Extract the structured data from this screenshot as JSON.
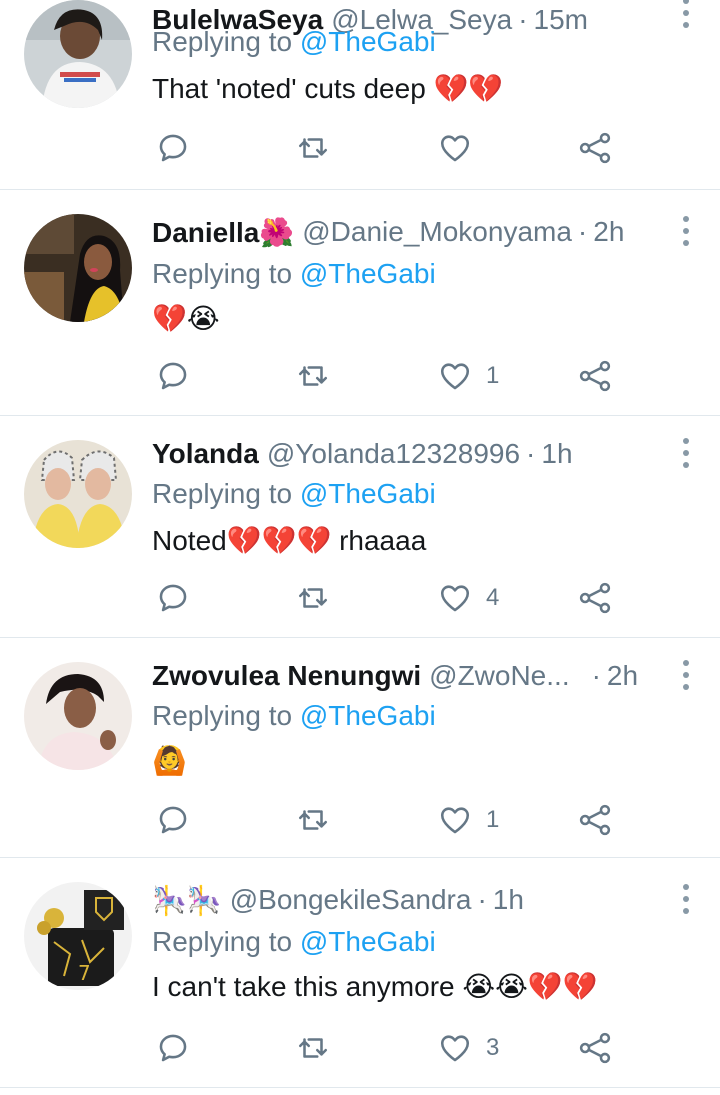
{
  "tweets": [
    {
      "name": "BulelwaSeya",
      "handle": "@Lelwa_Seya",
      "separator": "·",
      "time": "15m",
      "replying_prefix": "Replying to ",
      "replying_to": "@TheGabi",
      "text": "That 'noted' cuts deep 💔💔",
      "likes": ""
    },
    {
      "name": "Daniella🌺",
      "handle": "@Danie_Mokonyama",
      "separator": "·",
      "time": "2h",
      "replying_prefix": "Replying to ",
      "replying_to": "@TheGabi",
      "text": "💔😭",
      "likes": "1"
    },
    {
      "name": "Yolanda",
      "handle": "@Yolanda12328996",
      "separator": "·",
      "time": "1h",
      "replying_prefix": "Replying to ",
      "replying_to": "@TheGabi",
      "text": "Noted💔💔💔 rhaaaa",
      "likes": "4"
    },
    {
      "name": "Zwovulea Nenungwi",
      "handle": "@ZwoNe...",
      "separator": "·",
      "time": "2h",
      "replying_prefix": "Replying to ",
      "replying_to": "@TheGabi",
      "text": "🙆",
      "likes": "1"
    },
    {
      "name": "🎠🎠",
      "handle": "@BongekileSandra",
      "separator": "·",
      "time": "1h",
      "replying_prefix": "Replying to ",
      "replying_to": "@TheGabi",
      "text": "I can't take this anymore 😭😭💔💔",
      "likes": "3"
    }
  ],
  "icons": {
    "reply": "reply-icon",
    "retweet": "retweet-icon",
    "like": "heart-icon",
    "share": "share-icon",
    "more": "more-vertical-icon"
  },
  "colors": {
    "name": "#14171a",
    "secondary": "#657786",
    "mention": "#1da1f2",
    "divider": "#e1e8ed"
  }
}
